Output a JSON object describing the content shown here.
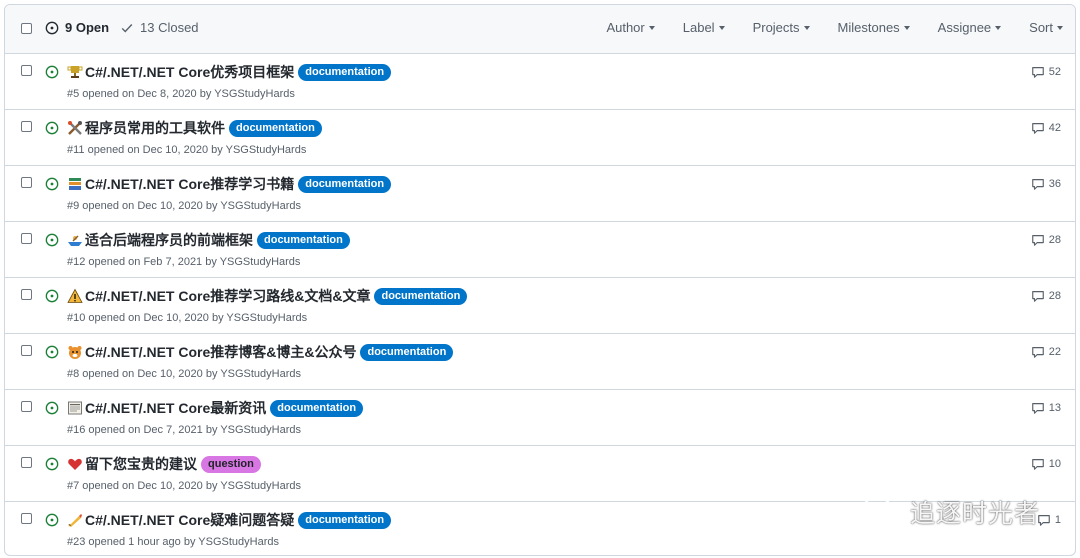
{
  "header": {
    "open_count": "9 Open",
    "closed_count": "13 Closed",
    "filters": [
      "Author",
      "Label",
      "Projects",
      "Milestones",
      "Assignee",
      "Sort"
    ]
  },
  "issues": [
    {
      "icon": "trophy-icon",
      "title": "C#/.NET/.NET Core优秀项目框架",
      "label": "documentation",
      "label_type": "doc",
      "meta": "#5 opened on Dec 8, 2020 by YSGStudyHards",
      "comments": "52"
    },
    {
      "icon": "tools-icon",
      "title": "程序员常用的工具软件",
      "label": "documentation",
      "label_type": "doc",
      "meta": "#11 opened on Dec 10, 2020 by YSGStudyHards",
      "comments": "42"
    },
    {
      "icon": "books-icon",
      "title": "C#/.NET/.NET Core推荐学习书籍",
      "label": "documentation",
      "label_type": "doc",
      "meta": "#9 opened on Dec 10, 2020 by YSGStudyHards",
      "comments": "36"
    },
    {
      "icon": "rowboat-icon",
      "title": "适合后端程序员的前端框架",
      "label": "documentation",
      "label_type": "doc",
      "meta": "#12 opened on Feb 7, 2021 by YSGStudyHards",
      "comments": "28"
    },
    {
      "icon": "warning-icon",
      "title": "C#/.NET/.NET Core推荐学习路线&文档&文章",
      "label": "documentation",
      "label_type": "doc",
      "meta": "#10 opened on Dec 10, 2020 by YSGStudyHards",
      "comments": "28"
    },
    {
      "icon": "tiger-icon",
      "title": "C#/.NET/.NET Core推荐博客&博主&公众号",
      "label": "documentation",
      "label_type": "doc",
      "meta": "#8 opened on Dec 10, 2020 by YSGStudyHards",
      "comments": "22"
    },
    {
      "icon": "newspaper-icon",
      "title": "C#/.NET/.NET Core最新资讯",
      "label": "documentation",
      "label_type": "doc",
      "meta": "#16 opened on Dec 7, 2021 by YSGStudyHards",
      "comments": "13"
    },
    {
      "icon": "heart-icon",
      "title": "留下您宝贵的建议",
      "label": "question",
      "label_type": "question",
      "meta": "#7 opened on Dec 10, 2020 by YSGStudyHards",
      "comments": "10"
    },
    {
      "icon": "writing-hand-icon",
      "title": "C#/.NET/.NET Core疑难问题答疑",
      "label": "documentation",
      "label_type": "doc",
      "meta": "#23 opened 1 hour ago by YSGStudyHards",
      "comments": "1"
    }
  ],
  "watermark": {
    "text": "追逐时光者"
  },
  "colors": {
    "open_green": "#1a7f37",
    "doc_label": "#0075ca",
    "question_label": "#d876e3",
    "border": "#d0d7de"
  }
}
